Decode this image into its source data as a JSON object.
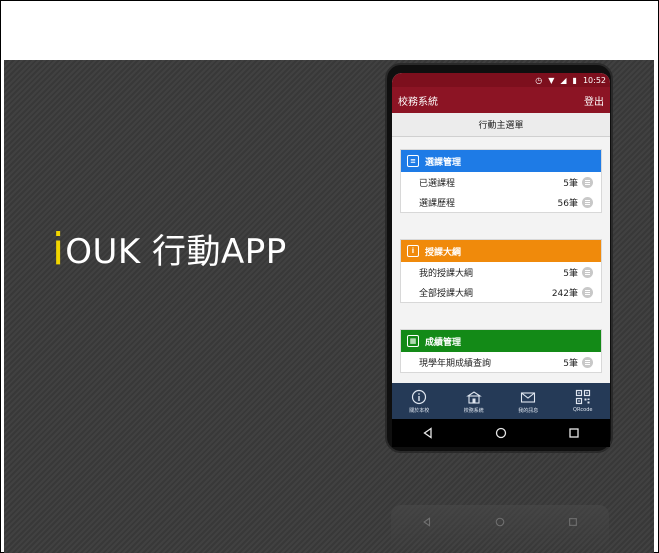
{
  "headline": {
    "prefix": "i",
    "rest": "OUK 行動APP"
  },
  "phone": {
    "status": {
      "time": "10:52"
    },
    "appbar": {
      "title": "校務系統",
      "logout": "登出"
    },
    "page_title": "行動主選單",
    "cards": [
      {
        "title": "選課管理",
        "icon": "document-icon",
        "color": "#1e7be6",
        "rows": [
          {
            "label": "已選課程",
            "count": "5筆"
          },
          {
            "label": "選課歷程",
            "count": "56筆"
          }
        ]
      },
      {
        "title": "授課大綱",
        "icon": "info-icon",
        "color": "#f08a0b",
        "rows": [
          {
            "label": "我的授課大綱",
            "count": "5筆"
          },
          {
            "label": "全部授課大綱",
            "count": "242筆"
          }
        ]
      },
      {
        "title": "成績管理",
        "icon": "calculator-icon",
        "color": "#138a17",
        "rows": [
          {
            "label": "現學年期成績查詢",
            "count": "5筆"
          }
        ]
      }
    ],
    "tabs": [
      {
        "label": "關於本校",
        "icon": "info-circle-icon"
      },
      {
        "label": "校務系統",
        "icon": "school-icon"
      },
      {
        "label": "我的訊息",
        "icon": "mail-icon"
      },
      {
        "label": "QRcode",
        "icon": "qrcode-icon"
      }
    ],
    "nav": [
      "back-icon",
      "home-icon",
      "recents-icon"
    ]
  }
}
